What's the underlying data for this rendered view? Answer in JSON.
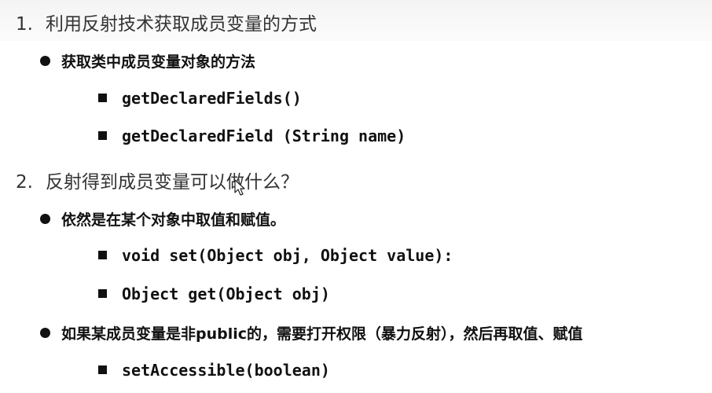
{
  "section1": {
    "number": "1.",
    "title": "利用反射技术获取成员变量的方式",
    "bullets": [
      {
        "text": "获取类中成员变量对象的方法",
        "items": [
          "getDeclaredFields()",
          "getDeclaredField (String name)"
        ]
      }
    ]
  },
  "section2": {
    "number": "2.",
    "title": "反射得到成员变量可以做什么？",
    "bullets": [
      {
        "text": "依然是在某个对象中取值和赋值。",
        "items": [
          "void set(Object obj, Object value):",
          "Object get(Object obj)"
        ]
      },
      {
        "text": "如果某成员变量是非public的，需要打开权限（暴力反射），然后再取值、赋值",
        "items": [
          "setAccessible(boolean)"
        ]
      }
    ]
  },
  "cursor_icon": "mouse-pointer-icon"
}
